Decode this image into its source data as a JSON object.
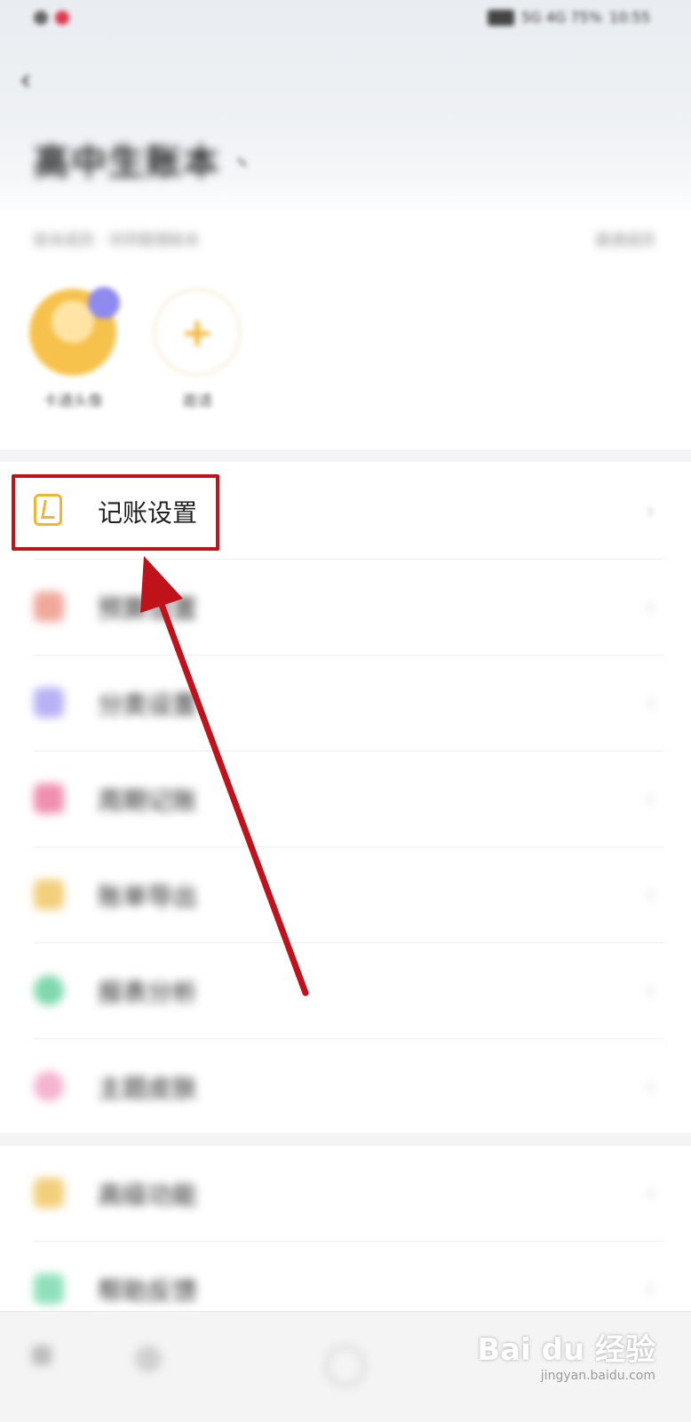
{
  "status_bar": {
    "time": "10:55",
    "right_text": "5G 4G 75%"
  },
  "header": {
    "back_icon": "back-arrow-icon",
    "title": "高中生账本",
    "edit_mark": "✎"
  },
  "members": {
    "label": "账本成员 · 共同管理账本",
    "right_label": "邀请成员",
    "items": [
      {
        "name": "卡通头像",
        "type": "avatar"
      },
      {
        "name": "邀请",
        "type": "add"
      }
    ]
  },
  "menu": {
    "items": [
      {
        "label": "记账设置",
        "icon": "ledger-icon",
        "color": "#f2b533"
      },
      {
        "label": "预算设置",
        "icon": "budget-icon",
        "color": "#f0a89a"
      },
      {
        "label": "分类设置",
        "icon": "category-icon",
        "color": "#b8b2f5"
      },
      {
        "label": "周期记账",
        "icon": "cycle-icon",
        "color": "#f08fb0"
      },
      {
        "label": "账单导出",
        "icon": "export-icon",
        "color": "#f2cf7a"
      },
      {
        "label": "报表分析",
        "icon": "report-icon",
        "color": "#7fd8ad"
      },
      {
        "label": "主题皮肤",
        "icon": "theme-icon",
        "color": "#f5b3cf"
      }
    ],
    "section2": [
      {
        "label": "高级功能",
        "icon": "advanced-icon",
        "color": "#f2cf7a"
      },
      {
        "label": "帮助反馈",
        "icon": "help-icon",
        "color": "#8fe0bb"
      }
    ]
  },
  "highlight": {
    "color": "#c0121b"
  },
  "watermark": {
    "brand": "Bai du 经验",
    "url": "jingyan.baidu.com"
  }
}
